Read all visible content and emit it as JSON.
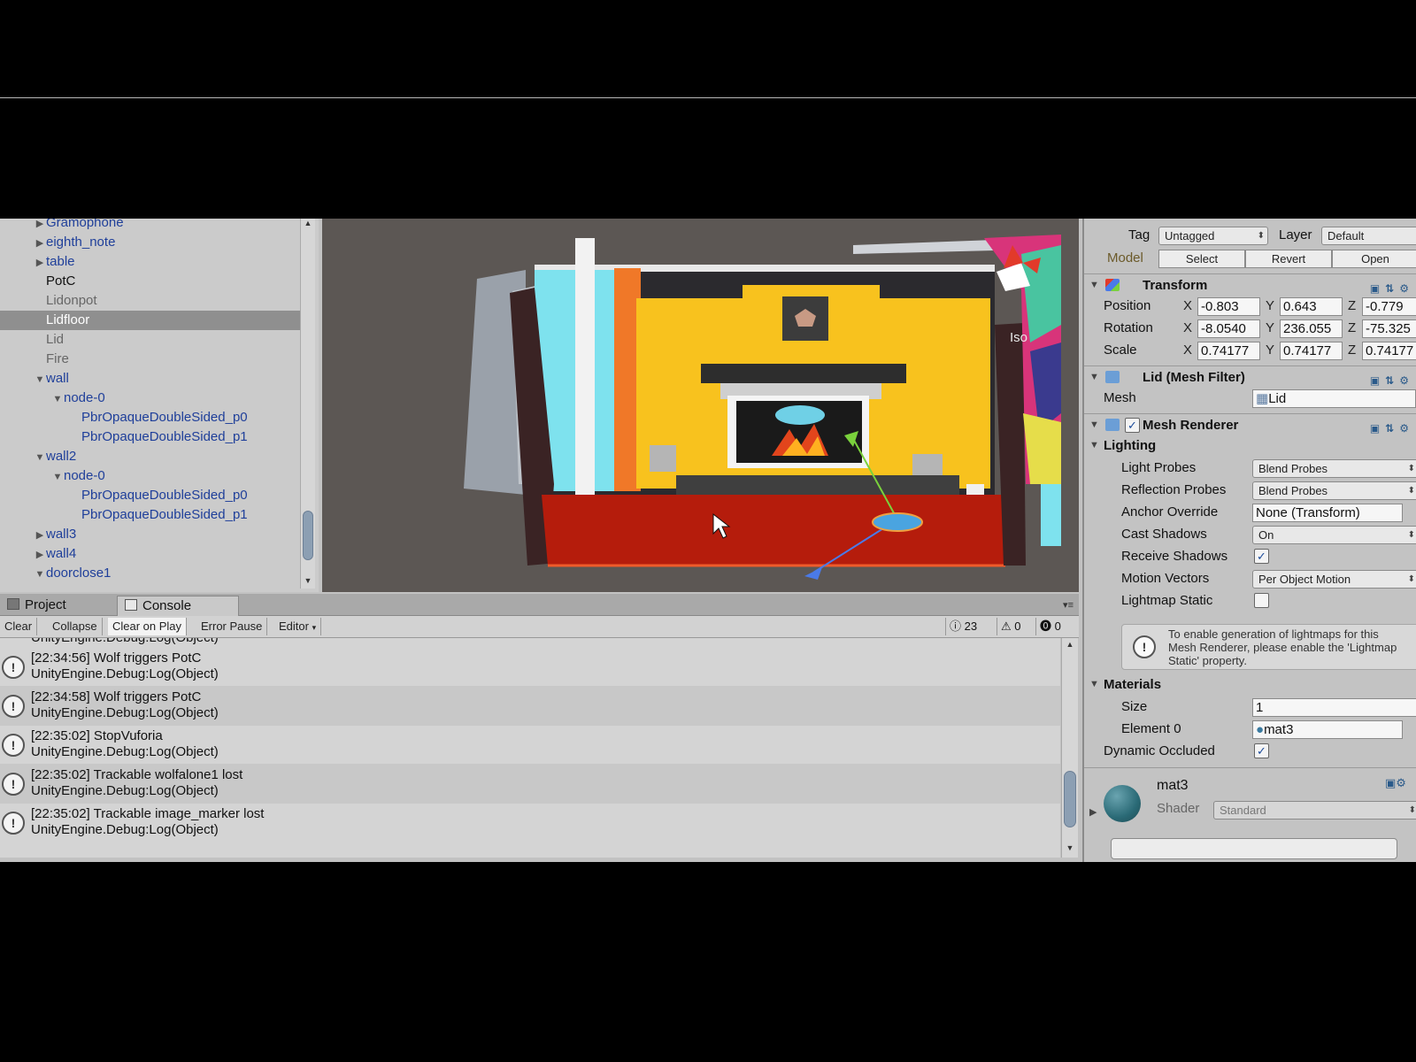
{
  "hierarchy": {
    "items": [
      {
        "label": "Gramophone",
        "arrow": "▶",
        "style": "blue",
        "indent": 0
      },
      {
        "label": "eighth_note",
        "arrow": "▶",
        "style": "blue",
        "indent": 0
      },
      {
        "label": "table",
        "arrow": "▶",
        "style": "blue",
        "indent": 0
      },
      {
        "label": "PotC",
        "arrow": "",
        "style": "black",
        "indent": 0
      },
      {
        "label": "Lidonpot",
        "arrow": "",
        "style": "gray",
        "indent": 0
      },
      {
        "label": "Lidfloor",
        "arrow": "",
        "style": "gray",
        "indent": 0,
        "selected": true
      },
      {
        "label": "Lid",
        "arrow": "",
        "style": "gray",
        "indent": 0
      },
      {
        "label": "Fire",
        "arrow": "",
        "style": "gray",
        "indent": 0
      },
      {
        "label": "wall",
        "arrow": "▼",
        "style": "blue",
        "indent": 0
      },
      {
        "label": "node-0",
        "arrow": "▼",
        "style": "blue",
        "indent": 1
      },
      {
        "label": "PbrOpaqueDoubleSided_p0",
        "arrow": "",
        "style": "blue",
        "indent": 2
      },
      {
        "label": "PbrOpaqueDoubleSided_p1",
        "arrow": "",
        "style": "blue",
        "indent": 2
      },
      {
        "label": "wall2",
        "arrow": "▼",
        "style": "blue",
        "indent": 0
      },
      {
        "label": "node-0",
        "arrow": "▼",
        "style": "blue",
        "indent": 1
      },
      {
        "label": "PbrOpaqueDoubleSided_p0",
        "arrow": "",
        "style": "blue",
        "indent": 2
      },
      {
        "label": "PbrOpaqueDoubleSided_p1",
        "arrow": "",
        "style": "blue",
        "indent": 2
      },
      {
        "label": "wall3",
        "arrow": "▶",
        "style": "blue",
        "indent": 0
      },
      {
        "label": "wall4",
        "arrow": "▶",
        "style": "blue",
        "indent": 0
      },
      {
        "label": "doorclose1",
        "arrow": "▼",
        "style": "blue",
        "indent": 0
      }
    ]
  },
  "scene": {
    "iso_label": "Iso"
  },
  "console": {
    "tabs": {
      "project": "Project",
      "console": "Console"
    },
    "toolbar": {
      "clear": "Clear",
      "collapse": "Collapse",
      "clear_on_play": "Clear on Play",
      "error_pause": "Error Pause",
      "editor": "Editor"
    },
    "counts": {
      "info": "23",
      "warnings": "0",
      "errors": "0"
    },
    "partial_top": "UnityEngine.Debug:Log(Object)",
    "logs": [
      {
        "line1": "[22:34:56] Wolf triggers  PotC",
        "line2": "UnityEngine.Debug:Log(Object)"
      },
      {
        "line1": "[22:34:58] Wolf triggers  PotC",
        "line2": "UnityEngine.Debug:Log(Object)"
      },
      {
        "line1": "[22:35:02] StopVuforia",
        "line2": "UnityEngine.Debug:Log(Object)"
      },
      {
        "line1": "[22:35:02] Trackable wolfalone1 lost",
        "line2": "UnityEngine.Debug:Log(Object)"
      },
      {
        "line1": "[22:35:02] Trackable image_marker lost",
        "line2": "UnityEngine.Debug:Log(Object)"
      }
    ]
  },
  "inspector": {
    "tag_label": "Tag",
    "tag_value": "Untagged",
    "layer_label": "Layer",
    "layer_value": "Default",
    "model_label": "Model",
    "model_buttons": {
      "select": "Select",
      "revert": "Revert",
      "open": "Open"
    },
    "transform": {
      "title": "Transform",
      "position_label": "Position",
      "rotation_label": "Rotation",
      "scale_label": "Scale",
      "position": {
        "x": "-0.803",
        "y": "0.643",
        "z": "-0.779"
      },
      "rotation": {
        "x": "-8.0540",
        "y": "236.055",
        "z": "-75.325"
      },
      "scale": {
        "x": "0.74177",
        "y": "0.74177",
        "z": "0.74177"
      },
      "axis_x": "X",
      "axis_y": "Y",
      "axis_z": "Z"
    },
    "mesh_filter": {
      "title": "Lid (Mesh Filter)",
      "mesh_label": "Mesh",
      "mesh_value": "Lid"
    },
    "mesh_renderer": {
      "title": "Mesh Renderer",
      "lighting_label": "Lighting",
      "light_probes_label": "Light Probes",
      "light_probes_value": "Blend Probes",
      "reflection_probes_label": "Reflection Probes",
      "reflection_probes_value": "Blend Probes",
      "anchor_override_label": "Anchor Override",
      "anchor_override_value": "None (Transform)",
      "cast_shadows_label": "Cast Shadows",
      "cast_shadows_value": "On",
      "receive_shadows_label": "Receive Shadows",
      "motion_vectors_label": "Motion Vectors",
      "motion_vectors_value": "Per Object Motion",
      "lightmap_static_label": "Lightmap Static",
      "help_text": "To enable generation of lightmaps for this\nMesh Renderer, please enable the 'Lightmap\nStatic' property.",
      "materials_label": "Materials",
      "size_label": "Size",
      "size_value": "1",
      "element0_label": "Element 0",
      "element0_value": "mat3",
      "dynamic_occluded_label": "Dynamic Occluded"
    },
    "material": {
      "name": "mat3",
      "shader_label": "Shader",
      "shader_value": "Standard"
    }
  }
}
